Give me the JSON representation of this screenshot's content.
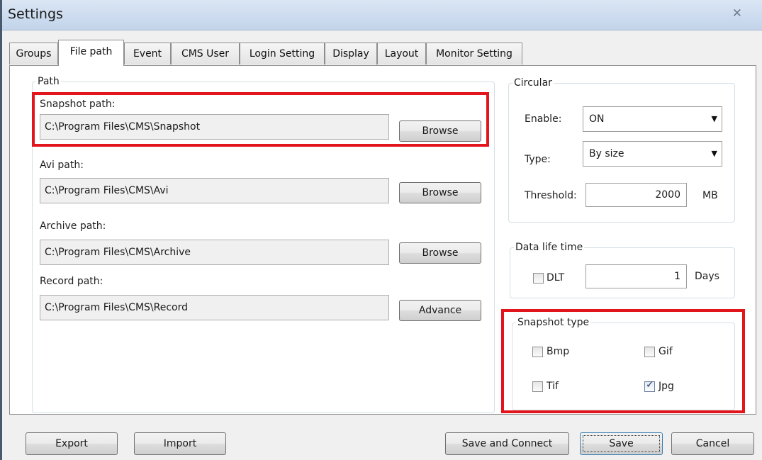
{
  "window": {
    "title": "Settings",
    "close_glyph": "✕"
  },
  "tabs": [
    {
      "label": "Groups"
    },
    {
      "label": "File path"
    },
    {
      "label": "Event"
    },
    {
      "label": "CMS User"
    },
    {
      "label": "Login Setting"
    },
    {
      "label": "Display"
    },
    {
      "label": "Layout"
    },
    {
      "label": "Monitor Setting"
    }
  ],
  "active_tab": "File path",
  "path_group": {
    "legend": "Path",
    "snapshot": {
      "label": "Snapshot path:",
      "value": "C:\\Program Files\\CMS\\Snapshot",
      "button": "Browse"
    },
    "avi": {
      "label": "Avi path:",
      "value": "C:\\Program Files\\CMS\\Avi",
      "button": "Browse"
    },
    "archive": {
      "label": "Archive path:",
      "value": "C:\\Program Files\\CMS\\Archive",
      "button": "Browse"
    },
    "record": {
      "label": "Record path:",
      "value": "C:\\Program Files\\CMS\\Record",
      "button": "Advance"
    }
  },
  "circular": {
    "legend": "Circular",
    "enable_label": "Enable:",
    "enable_value": "ON",
    "type_label": "Type:",
    "type_value": "By size",
    "threshold_label": "Threshold:",
    "threshold_value": "2000",
    "threshold_unit": "MB"
  },
  "data_life": {
    "legend": "Data life time",
    "dlt_label": "DLT",
    "dlt_checked": false,
    "days_value": "1",
    "days_unit": "Days"
  },
  "snapshot_type": {
    "legend": "Snapshot type",
    "bmp": {
      "label": "Bmp",
      "checked": false
    },
    "gif": {
      "label": "Gif",
      "checked": false
    },
    "tif": {
      "label": "Tif",
      "checked": false
    },
    "jpg": {
      "label": "Jpg",
      "checked": true
    }
  },
  "footer": {
    "export": "Export",
    "import": "Import",
    "save_connect": "Save and Connect",
    "save": "Save",
    "cancel": "Cancel"
  },
  "colors": {
    "highlight": "#e2141c",
    "titlebar": "#cddcef"
  }
}
